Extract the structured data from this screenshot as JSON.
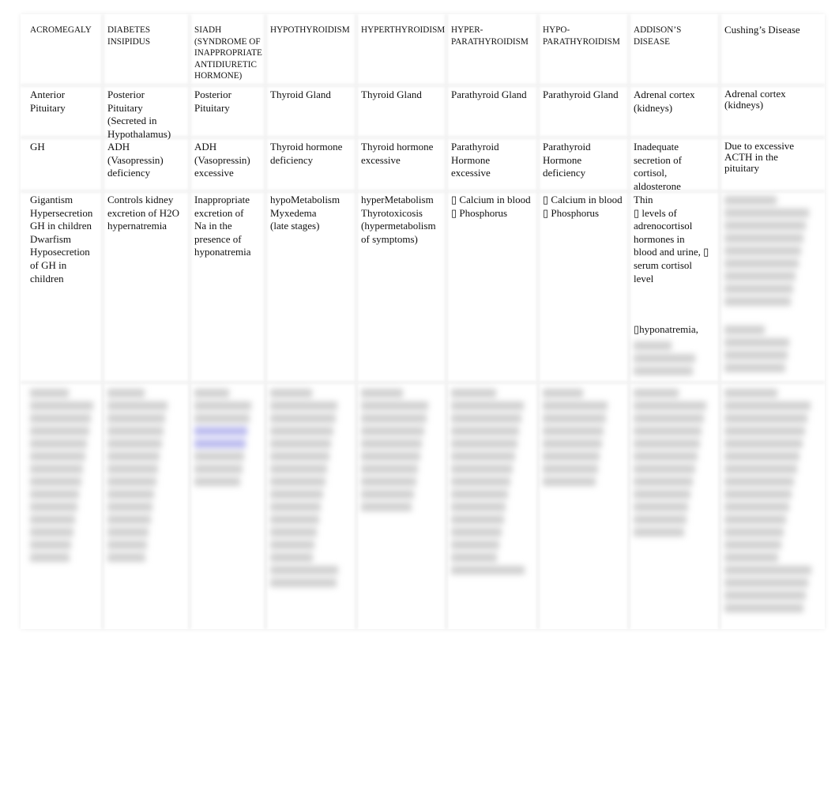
{
  "table": {
    "headers": [
      "ACROMEGALY",
      "DIABETES\nINSIPIDUS",
      "SIADH\n(SYNDROME OF\nINAPPROPRIATE\nANTIDIURETIC\nHORMONE)",
      "HYPOTHYROIDISM",
      "HYPERTHYROIDISM",
      "HYPER-\nPARATHYROIDISM",
      "HYPO-\nPARATHYROIDISM",
      "ADDISON’S\nDISEASE",
      "Cushing’s Disease"
    ],
    "rows": [
      [
        "Anterior\nPituitary",
        "Posterior\nPituitary\n(Secreted in\nHypothalamus)",
        "Posterior\nPituitary",
        "Thyroid Gland",
        "Thyroid Gland",
        "Parathyroid Gland",
        "Parathyroid Gland",
        "Adrenal cortex\n(kidneys)",
        "Adrenal cortex\n(kidneys)"
      ],
      [
        "GH",
        "ADH\n(Vasopressin)\ndeficiency",
        "ADH\n(Vasopressin)\nexcessive",
        "Thyroid hormone\ndeficiency",
        "Thyroid hormone\nexcessive",
        "Parathyroid\nHormone\nexcessive",
        "Parathyroid\nHormone\ndeficiency",
        "Inadequate\nsecretion of\ncortisol,\naldosterone",
        "Due to excessive\nACTH in the\npituitary"
      ],
      [
        "Gigantism\nHypersecretion\nGH in children\nDwarfism\nHyposecretion\nof GH in\nchildren",
        "Controls kidney\nexcretion of H2O\nhypernatremia",
        "Inappropriate\nexcretion of\nNa in the\npresence of\nhyponatremia",
        "hypoMetabolism\nMyxedema\n(late stages)",
        "hyperMetabolism\nThyrotoxicosis\n(hypermetabolism\nof symptoms)",
        "▯  Calcium in blood\n▯ Phosphorus",
        "▯ Calcium in blood\n▯ Phosphorus",
        "Thin\n▯ levels of\nadrenocortisol\nhormones in\nblood and urine,  ▯\nserum cortisol\nlevel",
        ""
      ]
    ],
    "addison_extra": "▯hyponatremia,"
  }
}
